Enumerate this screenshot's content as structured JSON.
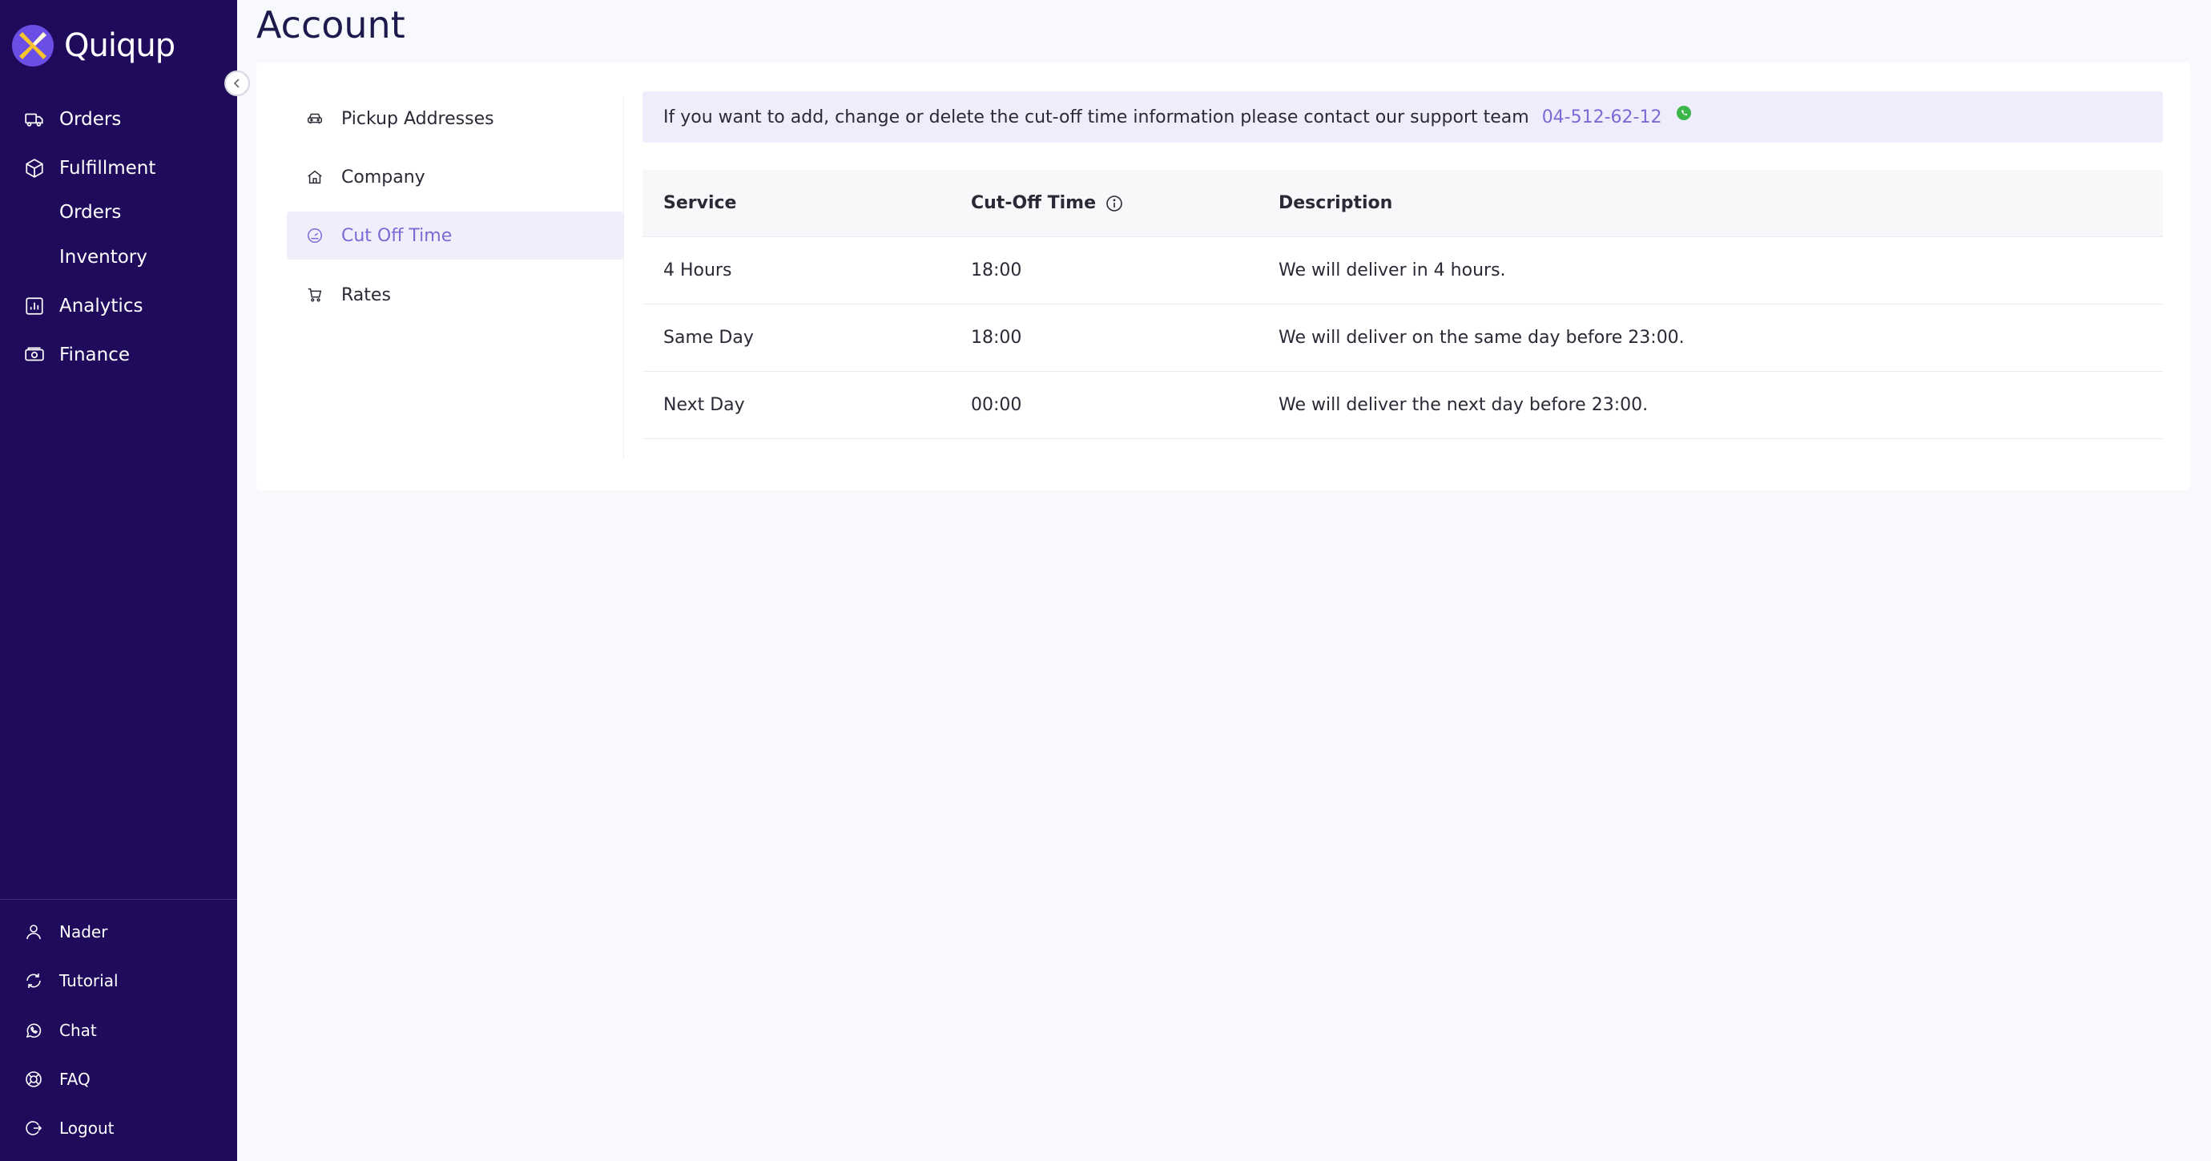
{
  "app": {
    "name": "Quiqup"
  },
  "sidebar": {
    "nav": [
      {
        "label": "Orders",
        "icon": "truck-icon"
      },
      {
        "label": "Fulfillment",
        "icon": "box-icon"
      },
      {
        "label": "Analytics",
        "icon": "chart-icon"
      },
      {
        "label": "Finance",
        "icon": "money-icon"
      }
    ],
    "fulfillment_sub": [
      "Orders",
      "Inventory"
    ],
    "bottom": [
      {
        "label": "Nader",
        "icon": "user-icon"
      },
      {
        "label": "Tutorial",
        "icon": "refresh-icon"
      },
      {
        "label": "Chat",
        "icon": "whatsapp-icon"
      },
      {
        "label": "FAQ",
        "icon": "lifebuoy-icon"
      },
      {
        "label": "Logout",
        "icon": "logout-icon"
      }
    ]
  },
  "page": {
    "title": "Account"
  },
  "account_nav": [
    {
      "label": "Pickup Addresses",
      "icon": "car-icon",
      "active": false
    },
    {
      "label": "Company",
      "icon": "home-icon",
      "active": false
    },
    {
      "label": "Cut Off Time",
      "icon": "gauge-icon",
      "active": true
    },
    {
      "label": "Rates",
      "icon": "cart-icon",
      "active": false
    }
  ],
  "notice": {
    "message": "If you want to add, change or delete the cut-off time information please contact our support team",
    "phone": "04-512-62-12"
  },
  "table": {
    "headers": [
      "Service",
      "Cut-Off Time",
      "Description"
    ],
    "rows": [
      {
        "service": "4 Hours",
        "time": "18:00",
        "description": "We will deliver in 4 hours."
      },
      {
        "service": "Same Day",
        "time": "18:00",
        "description": "We will deliver on the same day before 23:00."
      },
      {
        "service": "Next Day",
        "time": "00:00",
        "description": "We will deliver the next day before 23:00."
      }
    ]
  },
  "colors": {
    "sidebar_bg": "#1f0a5c",
    "accent": "#7a6ad6",
    "logo_yellow": "#f5c42c",
    "logo_purple": "#6b4ee6",
    "whatsapp": "#3cb54a"
  }
}
